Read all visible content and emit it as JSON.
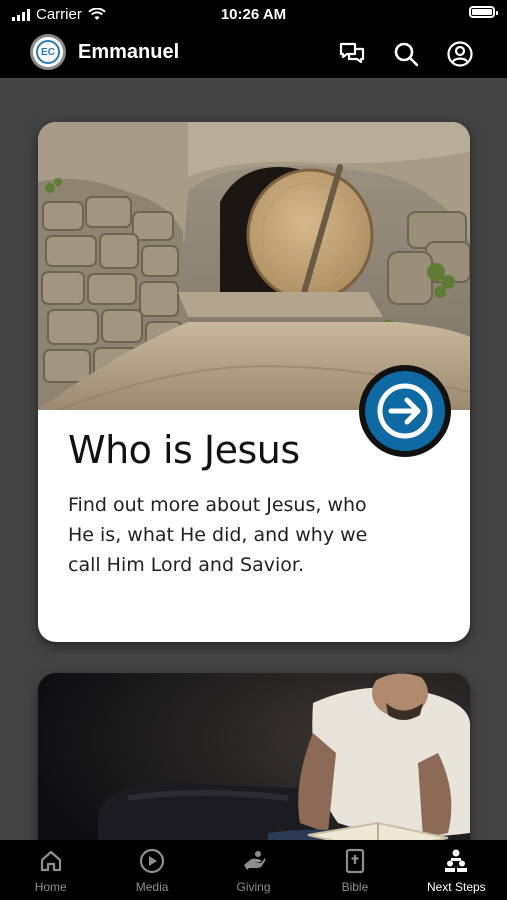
{
  "status": {
    "carrier": "Carrier",
    "time": "10:26 AM"
  },
  "header": {
    "logo_text": "EC",
    "church_name": "Emmanuel"
  },
  "cards": [
    {
      "title": "Who is Jesus",
      "description": "Find out more about Jesus, who He is, what He did, and why we call Him Lord and Savior."
    }
  ],
  "tabs": [
    {
      "label": "Home",
      "icon": "home-icon"
    },
    {
      "label": "Media",
      "icon": "play-icon"
    },
    {
      "label": "Giving",
      "icon": "giving-hand-icon"
    },
    {
      "label": "Bible",
      "icon": "bible-icon"
    },
    {
      "label": "Next Steps",
      "icon": "next-steps-icon",
      "active": true
    }
  ],
  "colors": {
    "accent": "#0f6aa3",
    "background": "#444444",
    "bar": "#000000"
  }
}
